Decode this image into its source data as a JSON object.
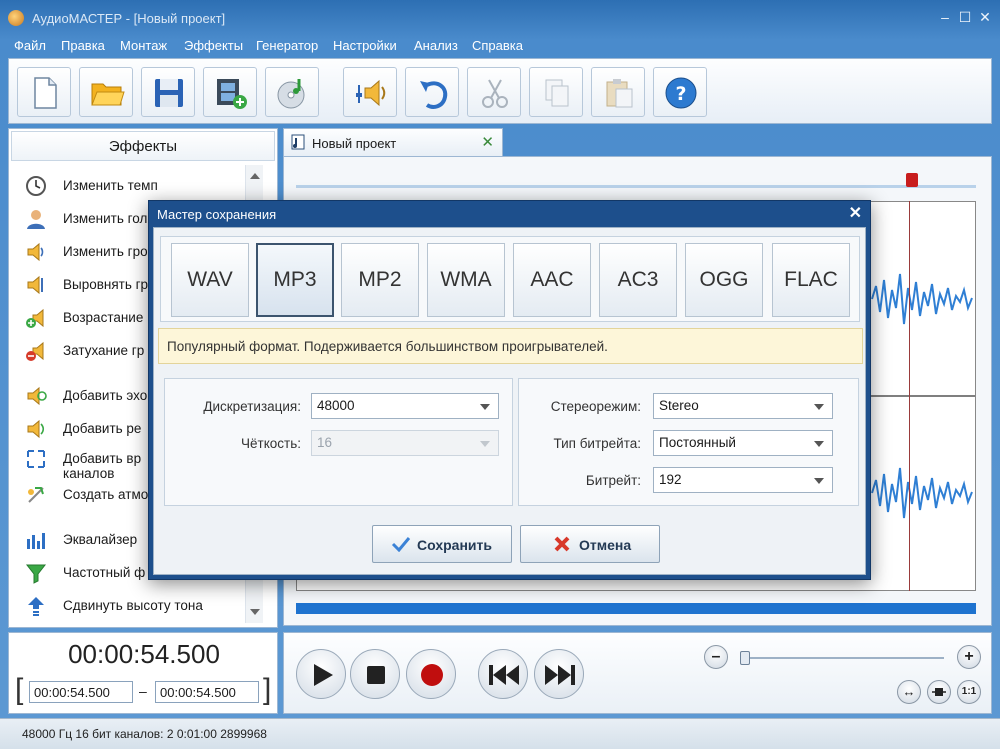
{
  "window": {
    "title": "АудиоМАСТЕР - [Новый проект]",
    "controls": {
      "minimize": "–",
      "maximize": "☐",
      "close": "✕"
    }
  },
  "menu": [
    "Файл",
    "Правка",
    "Монтаж",
    "Эффекты",
    "Генератор",
    "Настройки",
    "Анализ",
    "Справка"
  ],
  "toolbar": {
    "buttons": [
      "new-file",
      "open-folder",
      "save",
      "add-video",
      "extract-cd",
      "audio-settings",
      "undo",
      "cut",
      "copy",
      "paste",
      "help"
    ]
  },
  "effects_panel": {
    "header": "Эффекты",
    "items": [
      "Изменить темп",
      "Изменить голос",
      "Изменить громкость",
      "Выровнять громкость",
      "Возрастание громкости",
      "Затухание громкости",
      "Добавить эхо",
      "Добавить реверберацию",
      "Добавить вращение каналов",
      "Создать атмосферу",
      "Эквалайзер",
      "Частотный фильтр",
      "Сдвинуть высоту тона"
    ],
    "visible_labels": [
      "Изменить темп",
      "Изменить гол",
      "Изменить гро",
      "Выровнять гр",
      "Возрастание",
      "Затухание гр",
      "Добавить эхо",
      "Добавить ре",
      "Добавить вр",
      "каналов",
      "Создать атмо",
      "Эквалайзер",
      "Частотный ф",
      "Сдвинуть высоту тона"
    ]
  },
  "project": {
    "tab_label": "Новый проект",
    "tab_close": "✕"
  },
  "time": {
    "current": "00:00:54.500",
    "start": "00:00:54.500",
    "end": "00:00:54.500",
    "bracket_open": "[",
    "bracket_close": "]",
    "separator": "–"
  },
  "transport": {
    "zoom_out": "–",
    "zoom_in": "+",
    "fit": "↔",
    "ratio": "1:1"
  },
  "status": "48000 Гц  16 бит  каналов: 2   0:01:00 2899968",
  "dialog": {
    "title": "Мастер сохранения",
    "close": "✕",
    "formats": [
      "WAV",
      "MP3",
      "MP2",
      "WMA",
      "AAC",
      "AC3",
      "OGG",
      "FLAC"
    ],
    "selected_format": "MP3",
    "hint": "Популярный формат. Подерживается большинством проигрывателей.",
    "left": {
      "sample_rate_label": "Дискретизация:",
      "sample_rate_value": "48000",
      "bit_depth_label": "Чёткость:",
      "bit_depth_value": "16"
    },
    "right": {
      "stereo_label": "Стереорежим:",
      "stereo_value": "Stereo",
      "bitrate_type_label": "Тип битрейта:",
      "bitrate_type_value": "Постоянный",
      "bitrate_label": "Битрейт:",
      "bitrate_value": "192"
    },
    "save_label": "Сохранить",
    "cancel_label": "Отмена"
  },
  "colors": {
    "frame": "#4a8bcc",
    "dialog_title": "#1d4f8c",
    "progress": "#1e73cf",
    "playhead": "#c81d1d",
    "wave": "#2f7fd4"
  }
}
